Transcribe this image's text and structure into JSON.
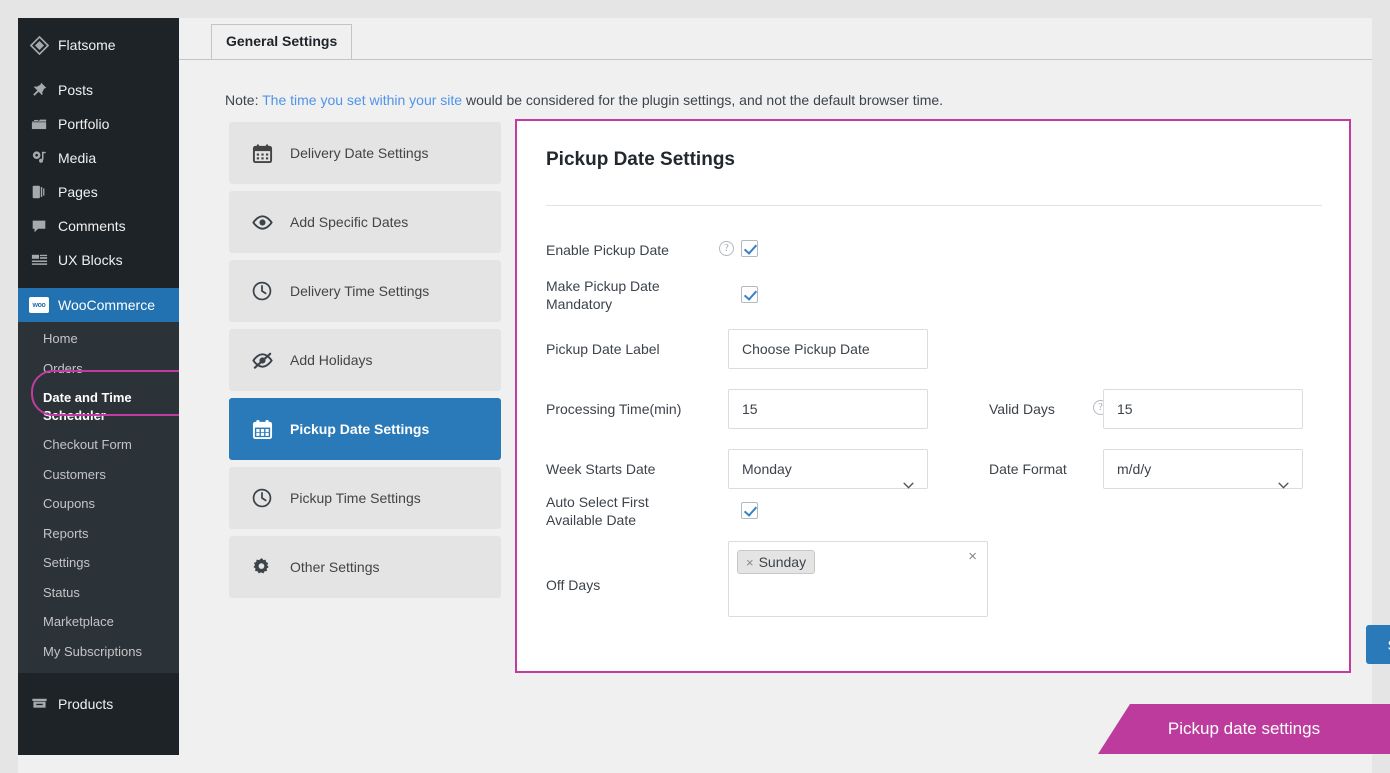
{
  "sidebar": {
    "top_items": [
      {
        "label": "Flatsome",
        "icon": "flatsome-diamond-icon",
        "active": false
      },
      {
        "label": "Posts",
        "icon": "pin-icon",
        "active": false
      },
      {
        "label": "Portfolio",
        "icon": "portfolio-folder-icon",
        "active": false
      },
      {
        "label": "Media",
        "icon": "media-icon",
        "active": false
      },
      {
        "label": "Pages",
        "icon": "pages-icon",
        "active": false
      },
      {
        "label": "Comments",
        "icon": "comment-bubble-icon",
        "active": false
      },
      {
        "label": "UX Blocks",
        "icon": "ux-blocks-icon",
        "active": false
      }
    ],
    "woocommerce": {
      "label": "WooCommerce",
      "icon": "woo-icon",
      "badge_text": "woo",
      "active": true
    },
    "submenu": [
      {
        "label": "Home",
        "current": false
      },
      {
        "label": "Orders",
        "current": false
      },
      {
        "label": "Date and Time Scheduler",
        "current": true
      },
      {
        "label": "Checkout Form",
        "current": false
      },
      {
        "label": "Customers",
        "current": false
      },
      {
        "label": "Coupons",
        "current": false
      },
      {
        "label": "Reports",
        "current": false
      },
      {
        "label": "Settings",
        "current": false
      },
      {
        "label": "Status",
        "current": false
      },
      {
        "label": "Marketplace",
        "current": false
      },
      {
        "label": "My Subscriptions",
        "current": false
      }
    ],
    "bottom_items": [
      {
        "label": "Products",
        "icon": "products-box-icon",
        "active": false
      }
    ],
    "highlight_color": "#c13c9e"
  },
  "tabs": [
    {
      "label": "General Settings",
      "active": true
    }
  ],
  "note": {
    "prefix": "Note:",
    "link_text": "The time you set within your site",
    "suffix": "would be considered for the plugin settings, and not the default browser time."
  },
  "settings_menu": [
    {
      "label": "Delivery Date Settings",
      "icon": "calendar-icon",
      "active": false
    },
    {
      "label": "Add Specific Dates",
      "icon": "eye-icon",
      "active": false
    },
    {
      "label": "Delivery Time Settings",
      "icon": "clock-icon",
      "active": false
    },
    {
      "label": "Add Holidays",
      "icon": "eye-slash-icon",
      "active": false
    },
    {
      "label": "Pickup Date Settings",
      "icon": "calendar-icon",
      "active": true
    },
    {
      "label": "Pickup Time Settings",
      "icon": "clock-icon",
      "active": false
    },
    {
      "label": "Other Settings",
      "icon": "gear-icon",
      "active": false
    }
  ],
  "panel": {
    "title": "Pickup Date Settings",
    "border_color": "#c13c9e",
    "fields": {
      "enable_pickup_date": {
        "label": "Enable Pickup Date",
        "checked": true,
        "has_help": true
      },
      "mandatory": {
        "label": "Make Pickup Date Mandatory",
        "checked": true,
        "has_help": false
      },
      "pickup_date_label": {
        "label": "Pickup Date Label",
        "value": "Choose Pickup Date"
      },
      "processing_time": {
        "label": "Processing Time(min)",
        "value": "15"
      },
      "valid_days": {
        "label": "Valid Days",
        "value": "15",
        "has_help": true
      },
      "week_starts_date": {
        "label": "Week Starts Date",
        "value": "Monday"
      },
      "date_format": {
        "label": "Date Format",
        "value": "m/d/y"
      },
      "auto_select_first": {
        "label": "Auto Select First Available Date",
        "checked": true
      },
      "off_days": {
        "label": "Off Days",
        "tags": [
          "Sunday"
        ],
        "remove_symbol": "×",
        "clear_symbol": "×"
      }
    },
    "save_label": "Save Changes",
    "save_color": "#2a7ab9"
  },
  "callout": {
    "text": "Pickup date settings",
    "color": "#bd3b9c"
  }
}
